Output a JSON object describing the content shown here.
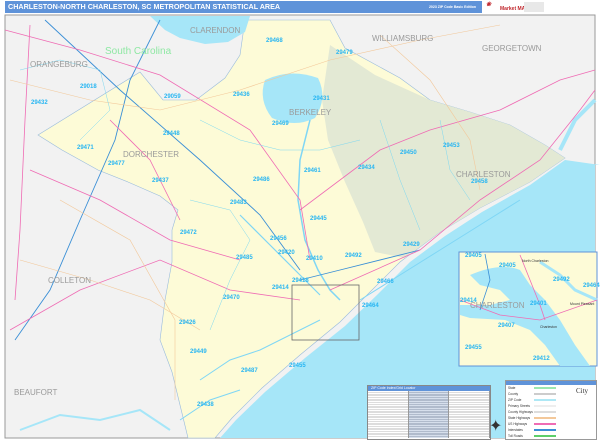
{
  "header": {
    "title": "CHARLESTON-NORTH CHARLESTON, SC METROPOLITAN STATISTICAL AREA",
    "edition": "2023 ZIP Code Basic Edition",
    "logo_text": "Market MAPS"
  },
  "colors": {
    "header": "#5f93d9",
    "metro_area": "#fdfbd7",
    "charleston_county_shade": "#e3e9d4",
    "outside_area": "#f2f2f2",
    "water": "#a6e6f8",
    "zip_label": "#29b6f2",
    "us_highway": "#ef6cb4",
    "interstate": "#3a8fd6"
  },
  "map": {
    "state_label": "South Carolina",
    "counties": {
      "clarendon": "CLARENDON",
      "williamsburg": "WILLIAMSBURG",
      "georgetown": "GEORGETOWN",
      "orangeburg": "ORANGEBURG",
      "berkeley": "BERKELEY",
      "dorchester": "DORCHESTER",
      "charleston": "CHARLESTON",
      "colleton": "COLLETON",
      "beaufort": "BEAUFORT"
    },
    "zips": [
      "29468",
      "29479",
      "29018",
      "29432",
      "29059",
      "29436",
      "29431",
      "29469",
      "29448",
      "29471",
      "29477",
      "29437",
      "29486",
      "29450",
      "29453",
      "29434",
      "29461",
      "29458",
      "29483",
      "29445",
      "29472",
      "29456",
      "29420",
      "29485",
      "29410",
      "29492",
      "29429",
      "29418",
      "29466",
      "29414",
      "29470",
      "29464",
      "29426",
      "29449",
      "29455",
      "29487",
      "29438"
    ]
  },
  "inset": {
    "city_label": "CHARLESTON",
    "towns": [
      "North Charleston",
      "Charleston",
      "Mount Pleasant"
    ],
    "zips": [
      "29405",
      "29492",
      "29464",
      "29414",
      "29407",
      "29455",
      "29412",
      "29401"
    ]
  },
  "zip_index": {
    "title": "ZIP Code Index/Grid Locator"
  },
  "legend": {
    "items": [
      "State",
      "County",
      "ZIP Code",
      "Primary Streets",
      "County Highways",
      "State Highways",
      "US Highways",
      "Interstates",
      "Toll Roads"
    ],
    "city_sample": "City"
  }
}
